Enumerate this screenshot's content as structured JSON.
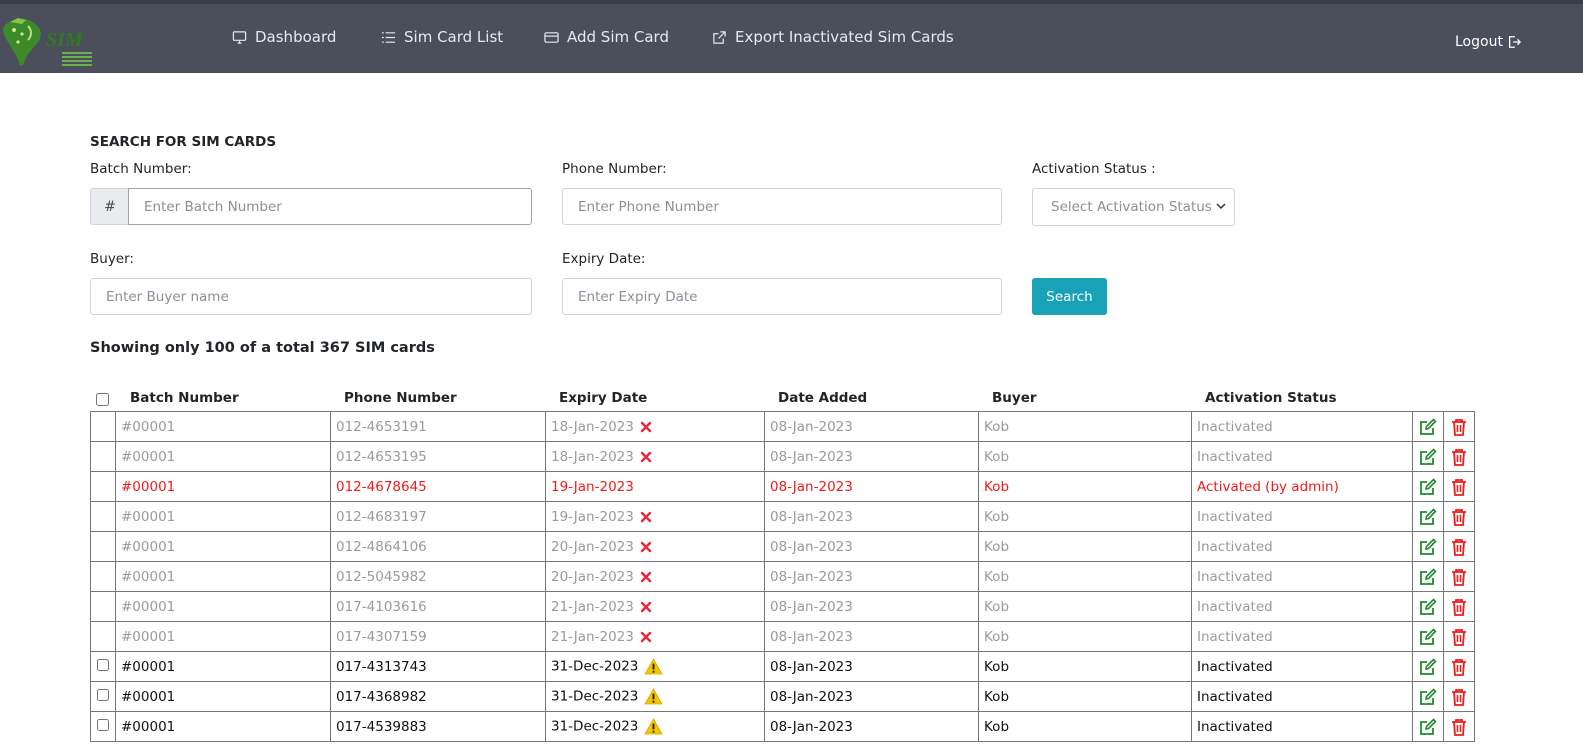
{
  "nav": {
    "items": [
      {
        "label": "Dashboard",
        "icon": "monitor-icon"
      },
      {
        "label": "Sim Card List",
        "icon": "list-icon"
      },
      {
        "label": "Add Sim Card",
        "icon": "card-icon"
      },
      {
        "label": "Export Inactivated Sim Cards",
        "icon": "external-link-icon"
      }
    ],
    "logout_label": "Logout",
    "logo_text": "SIM"
  },
  "search": {
    "title": "SEARCH FOR SIM CARDS",
    "batch_label": "Batch Number:",
    "batch_prefix": "#",
    "batch_placeholder": "Enter Batch Number",
    "phone_label": "Phone Number:",
    "phone_placeholder": "Enter Phone Number",
    "status_label": "Activation Status :",
    "status_selected": "Select Activation Status",
    "buyer_label": "Buyer:",
    "buyer_placeholder": "Enter Buyer name",
    "expiry_label": "Expiry Date:",
    "expiry_placeholder": "Enter Expiry Date",
    "search_button": "Search"
  },
  "summary": "Showing only 100 of a total 367 SIM cards",
  "table": {
    "columns": [
      "Batch Number",
      "Phone Number",
      "Expiry Date",
      "Date Added",
      "Buyer",
      "Activation Status"
    ],
    "rows": [
      {
        "batch": "#00001",
        "phone": "012-4653191",
        "expiry": "18-Jan-2023",
        "added": "08-Jan-2023",
        "buyer": "Kob",
        "status": "Inactivated",
        "style": "dim",
        "flag": "expired",
        "checkbox": false
      },
      {
        "batch": "#00001",
        "phone": "012-4653195",
        "expiry": "18-Jan-2023",
        "added": "08-Jan-2023",
        "buyer": "Kob",
        "status": "Inactivated",
        "style": "dim",
        "flag": "expired",
        "checkbox": false
      },
      {
        "batch": "#00001",
        "phone": "012-4678645",
        "expiry": "19-Jan-2023",
        "added": "08-Jan-2023",
        "buyer": "Kob",
        "status": "Activated (by admin)",
        "style": "red",
        "flag": "none",
        "checkbox": false
      },
      {
        "batch": "#00001",
        "phone": "012-4683197",
        "expiry": "19-Jan-2023",
        "added": "08-Jan-2023",
        "buyer": "Kob",
        "status": "Inactivated",
        "style": "dim",
        "flag": "expired",
        "checkbox": false
      },
      {
        "batch": "#00001",
        "phone": "012-4864106",
        "expiry": "20-Jan-2023",
        "added": "08-Jan-2023",
        "buyer": "Kob",
        "status": "Inactivated",
        "style": "dim",
        "flag": "expired",
        "checkbox": false
      },
      {
        "batch": "#00001",
        "phone": "012-5045982",
        "expiry": "20-Jan-2023",
        "added": "08-Jan-2023",
        "buyer": "Kob",
        "status": "Inactivated",
        "style": "dim",
        "flag": "expired",
        "checkbox": false
      },
      {
        "batch": "#00001",
        "phone": "017-4103616",
        "expiry": "21-Jan-2023",
        "added": "08-Jan-2023",
        "buyer": "Kob",
        "status": "Inactivated",
        "style": "dim",
        "flag": "expired",
        "checkbox": false
      },
      {
        "batch": "#00001",
        "phone": "017-4307159",
        "expiry": "21-Jan-2023",
        "added": "08-Jan-2023",
        "buyer": "Kob",
        "status": "Inactivated",
        "style": "dim",
        "flag": "expired",
        "checkbox": false
      },
      {
        "batch": "#00001",
        "phone": "017-4313743",
        "expiry": "31-Dec-2023",
        "added": "08-Jan-2023",
        "buyer": "Kob",
        "status": "Inactivated",
        "style": "normal",
        "flag": "warning",
        "checkbox": true
      },
      {
        "batch": "#00001",
        "phone": "017-4368982",
        "expiry": "31-Dec-2023",
        "added": "08-Jan-2023",
        "buyer": "Kob",
        "status": "Inactivated",
        "style": "normal",
        "flag": "warning",
        "checkbox": true
      },
      {
        "batch": "#00001",
        "phone": "017-4539883",
        "expiry": "31-Dec-2023",
        "added": "08-Jan-2023",
        "buyer": "Kob",
        "status": "Inactivated",
        "style": "normal",
        "flag": "warning",
        "checkbox": true
      }
    ]
  },
  "colors": {
    "navbar": "#4a4f5b",
    "accent": "#17a2b8",
    "danger": "#ee1c1c",
    "edit": "#1e8a2e",
    "warning": "#f5c400"
  }
}
